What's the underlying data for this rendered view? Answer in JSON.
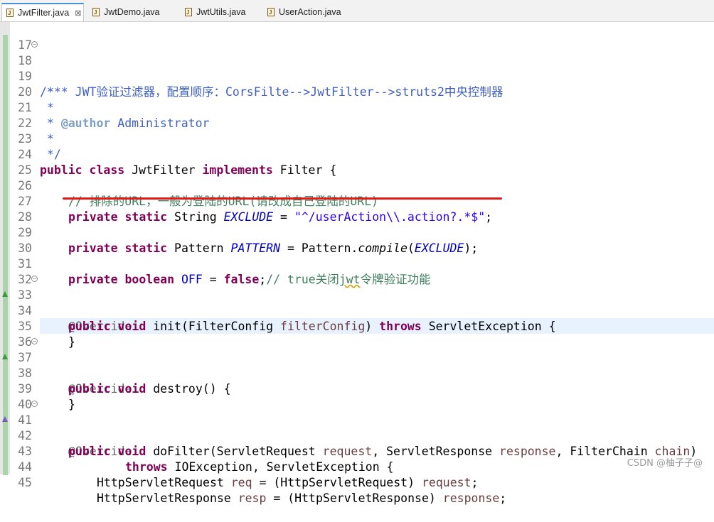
{
  "tabs": [
    {
      "label": "JwtFilter.java",
      "active": true,
      "close": "⊠"
    },
    {
      "label": "JwtDemo.java",
      "active": false
    },
    {
      "label": "JwtUtils.java",
      "active": false
    },
    {
      "label": "UserAction.java",
      "active": false
    }
  ],
  "line_numbers": {
    "l17": "17",
    "l18": "18",
    "l19": "19",
    "l20": "20",
    "l21": "21",
    "l22": "22",
    "l23": "23",
    "l24": "24",
    "l25": "25",
    "l26": "26",
    "l27": "27",
    "l28": "28",
    "l29": "29",
    "l30": "30",
    "l31": "31",
    "l32": "32",
    "l33": "33",
    "l34": "34",
    "l35": "35",
    "l36": "36",
    "l37": "37",
    "l38": "38",
    "l39": "39",
    "l40": "40",
    "l41": "41",
    "l42": "42",
    "l43": "43",
    "l44": "44",
    "l45": "45"
  },
  "code": {
    "l18_open": "/**",
    "l19_prefix": " * * ",
    "l19_text": "JWT验证过滤器，配置顺序：CorsFilte-->JwtFilter-->struts2中央控制器",
    "l20": " *",
    "l21_prefix": " * ",
    "l21_tag": "@author",
    "l21_text": " Administrator",
    "l22": " *",
    "l23": " */",
    "l24_kw1": "public",
    "l24_kw2": "class",
    "l24_name": "JwtFilter",
    "l24_kw3": "implements",
    "l24_rest": "Filter {",
    "l26_comment": "// 排除的URL，一般为登陆的URL(请改成自己登陆的URL)",
    "l27_kw1": "private",
    "l27_kw2": "static",
    "l27_type": "String",
    "l27_field": "EXCLUDE",
    "l27_eq": " = ",
    "l27_string": "\"^/userAction\\\\.action?.*$\"",
    "l27_end": ";",
    "l29_kw1": "private",
    "l29_kw2": "static",
    "l29_type": "Pattern",
    "l29_field": "PATTERN",
    "l29_eq": " = Pattern.",
    "l29_method": "compile",
    "l29_open": "(",
    "l29_arg": "EXCLUDE",
    "l29_end": ");",
    "l31_kw1": "private",
    "l31_kw2": "boolean",
    "l31_field": "OFF",
    "l31_eq": " = ",
    "l31_kw3": "false",
    "l31_semi": ";",
    "l31_comment_a": "// true关闭",
    "l31_comment_b": "jwt",
    "l31_comment_c": "令牌验证功能",
    "l33": "@Override",
    "l34_kw1": "public",
    "l34_kw2": "void",
    "l34_a": "init(FilterConfig ",
    "l34_param": "filterConfig",
    "l34_b": ") ",
    "l34_kw3": "throws",
    "l34_c": "ServletException {",
    "l35": "}",
    "l37": "@Override",
    "l38_kw1": "public",
    "l38_kw2": "void",
    "l38_a": "destroy() {",
    "l39": "}",
    "l41": "@Override",
    "l42_kw1": "public",
    "l42_kw2": "void",
    "l42_a": "doFilter(ServletRequest ",
    "l42_p1": "request",
    "l42_b": ", ServletResponse ",
    "l42_p2": "response",
    "l42_c": ", FilterChain ",
    "l42_p3": "chain",
    "l42_d": ")",
    "l43_kw": "throws",
    "l43_a": "IOException, ServletException {",
    "l44_a": "HttpServletRequest ",
    "l44_p": "req",
    "l44_b": " = (HttpServletRequest) ",
    "l44_c": "request",
    "l44_d": ";",
    "l45_a": "HttpServletResponse ",
    "l45_p": "resp",
    "l45_b": " = (HttpServletResponse) ",
    "l45_c": "response",
    "l45_d": ";"
  },
  "fold_markers": {
    "minus": "−"
  },
  "watermark": "CSDN @柚子子@",
  "colors": {
    "keyword": "#7f0055",
    "javadoc": "#3f5fbf",
    "comment": "#3f7f5f",
    "string": "#2a00ff",
    "field": "#0000c0",
    "param": "#6a3e3e",
    "annotation": "#646464",
    "underline": "#e01919"
  },
  "icons": {
    "file": "java-file-icon",
    "close": "close-icon",
    "fold": "fold-collapse-icon"
  }
}
